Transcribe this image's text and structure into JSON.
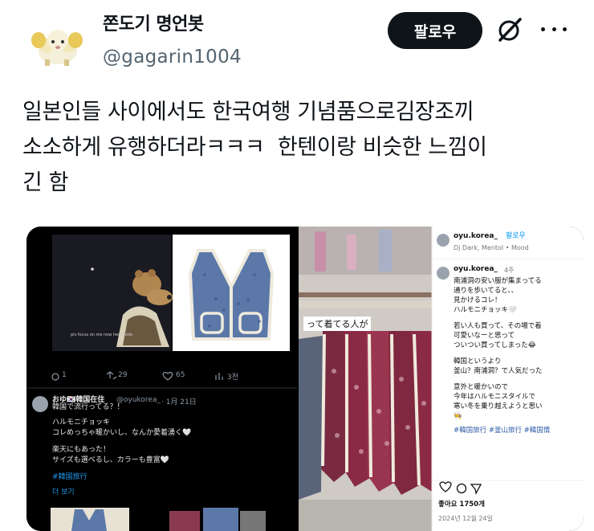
{
  "author": {
    "display_name": "쫀도기 명언봇",
    "handle": "@gagarin1004",
    "avatar_icon": "sheep-avatar-icon"
  },
  "actions": {
    "follow_label": "팔로우",
    "grok_icon": "grok-icon",
    "more_icon": "more-dots-icon"
  },
  "tweet": {
    "text": "일본인들 사이에서도 한국여행 기념품으로김장조끼\n소소하게 유행하더라ㅋㅋㅋ  한텐이랑 비슷한 느낌이\n긴 함"
  },
  "media_left": {
    "top_post": {
      "caption_overlay": "pls focus on me now her mode",
      "replies": "1",
      "retweets": "29",
      "likes": "65",
      "views": "3천"
    },
    "quoted_post": {
      "author": "おゆ🇰🇷韓国在住",
      "handle": "@oyukorea_",
      "date": "· 1月 21日",
      "lines": [
        "韓国で流行ってる？！",
        "",
        "ハルモニチョッキ",
        "コレめっちゃ暖かいし、なんか愛着湧く🤍",
        "",
        "楽天にもあった！",
        "サイズも選べるし、カラーも豊富🤍",
        "",
        "#韓国旅行"
      ],
      "more_label": "더 보기"
    }
  },
  "media_right": {
    "video_caption": "って着てる人が",
    "ig_user": "oyu.korea_",
    "ig_follow": "팔로우",
    "ig_music": "Dj Dark, Mentol • Mood",
    "ig_comment_user": "oyu.korea_",
    "ig_comment_time": "4주",
    "ig_comment_lines": [
      "南浦洞の安い服が集まってる",
      "通りを歩いてると、、",
      "見かけるコレ！",
      "ハルモニチョッキ🤍",
      "",
      "若い人も買って、その場で着",
      "可愛いなーと思って",
      "ついつい買ってしまった😂",
      "",
      "韓国というより",
      "釜山？南浦洞？で人気だった",
      "",
      "意外と暖かいので",
      "今年はハルモニスタイルで",
      "寒い冬を乗り越えようと思い",
      "🧑‍🍳",
      "",
      "#韓国旅行 #釜山旅行 #韓国情"
    ],
    "ig_likes": "좋아요 1750개",
    "ig_date": "2024년 12월 24일"
  },
  "colors": {
    "follow_bg": "#0f1419",
    "handle": "#536471",
    "vest_blue": "#5b78a8",
    "vest_red": "#8b2a45"
  }
}
